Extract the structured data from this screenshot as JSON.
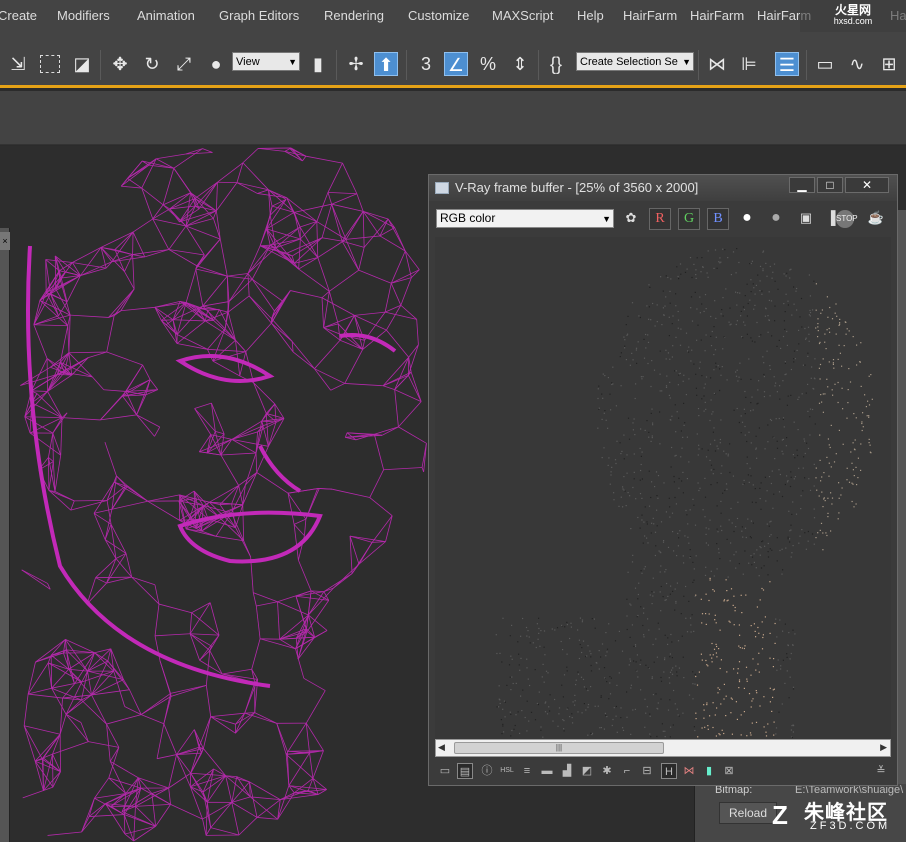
{
  "menu": {
    "items": [
      "Create",
      "Modifiers",
      "Animation",
      "Graph Editors",
      "Rendering",
      "Customize",
      "MAXScript",
      "Help",
      "HairFarm",
      "HairFarm",
      "HairFarm",
      "Ha"
    ]
  },
  "watermark_top": {
    "main": "火星网",
    "sub": "hxsd.com"
  },
  "toolbar": {
    "view_dropdown": "View",
    "snap_label": "3",
    "percent_snap_label": "%",
    "selection_set_placeholder": "Create Selection Se",
    "icons": [
      "select-object-icon",
      "rect-selection-icon",
      "window-crossing-icon",
      "move-icon",
      "rotate-icon",
      "scale-icon",
      "place-icon",
      "manipulate-icon",
      "use-pivot-icon",
      "select-manipulate-icon",
      "snaps-toggle-icon",
      "angle-snap-icon",
      "percent-snap-icon",
      "spinner-snap-icon",
      "edit-named-sel-icon",
      "mirror-icon",
      "align-icon",
      "layer-manager-icon",
      "scene-explorer-icon",
      "curve-editor-icon",
      "schematic-view-icon"
    ]
  },
  "colors": {
    "wireframe": "#c229b8",
    "accent_line": "#e6a317",
    "active_button": "#4d8fd1"
  },
  "vfb": {
    "title": "V-Ray frame buffer - [25% of 3560 x 2000]",
    "minimize": "▁",
    "maximize": "□",
    "close": "✕",
    "channel": "RGB color",
    "r": "R",
    "g": "G",
    "b": "B",
    "scroll_thumb": "|||",
    "bottom_h": "H"
  },
  "command_panel": {
    "bitmap_label": "Bitmap:",
    "bitmap_path": "E:\\Teamwork\\shuaige\\",
    "reload": "Reload"
  },
  "watermark_bottom": {
    "logo": "Z",
    "main": "朱峰社区",
    "sub": "ZF3D.COM"
  }
}
